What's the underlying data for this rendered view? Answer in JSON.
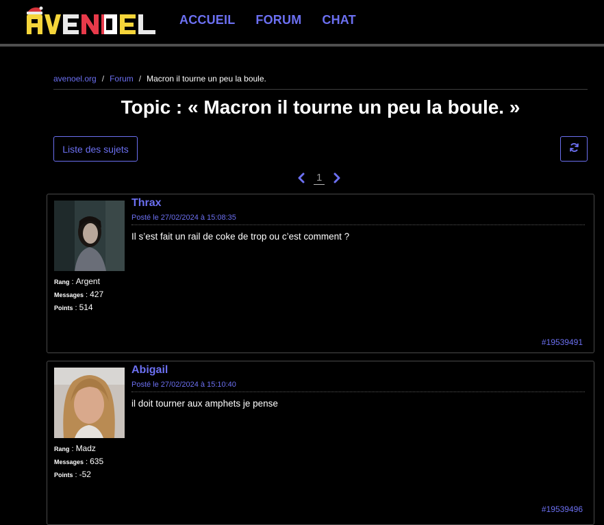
{
  "nav": {
    "logo_text": "AVENOEL",
    "links": [
      "ACCUEIL",
      "FORUM",
      "CHAT"
    ]
  },
  "breadcrumb": {
    "home": "avenoel.org",
    "forum": "Forum",
    "current": "Macron il tourne un peu la boule."
  },
  "title": "Topic : « Macron il tourne un peu la boule. »",
  "buttons": {
    "list_label": "Liste des sujets",
    "refresh_icon": "refresh-icon"
  },
  "pagination": {
    "current_page": "1"
  },
  "labels": {
    "rank": "Rang",
    "messages": "Messages",
    "points": "Points"
  },
  "posts": [
    {
      "author": "Thrax",
      "date": "Posté le 27/02/2024 à 15:08:35",
      "body": "Il s’est fait un rail de coke de trop ou c’est comment ?",
      "rank": "Argent",
      "messages": "427",
      "points": "514",
      "id": "#19539491"
    },
    {
      "author": "Abigail",
      "date": "Posté le 27/02/2024 à 15:10:40",
      "body": "il doit tourner aux amphets je pense",
      "rank": "Madz",
      "messages": "635",
      "points": "-52",
      "id": "#19539496"
    }
  ],
  "colors": {
    "accent": "#6c70f2",
    "background": "#000000",
    "border": "#4a4a4a"
  }
}
